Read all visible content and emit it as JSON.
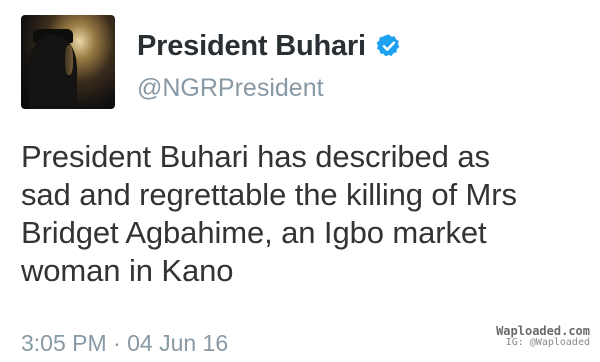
{
  "tweet": {
    "display_name": "President Buhari",
    "verified": true,
    "handle": "@NGRPresident",
    "text": "President Buhari has described as\nsad and regrettable the killing of Mrs\nBridget Agbahime, an Igbo market\nwoman in Kano",
    "timestamp": "3:05 PM · 04 Jun 16",
    "avatar_icon": "profile-photo"
  },
  "watermark": {
    "main": "Waploaded.com",
    "sub": "IG: @Waploaded"
  },
  "colors": {
    "name": "#292f33",
    "handle": "#8899a6",
    "text": "#333333",
    "verified_badge": "#1da1f2"
  }
}
